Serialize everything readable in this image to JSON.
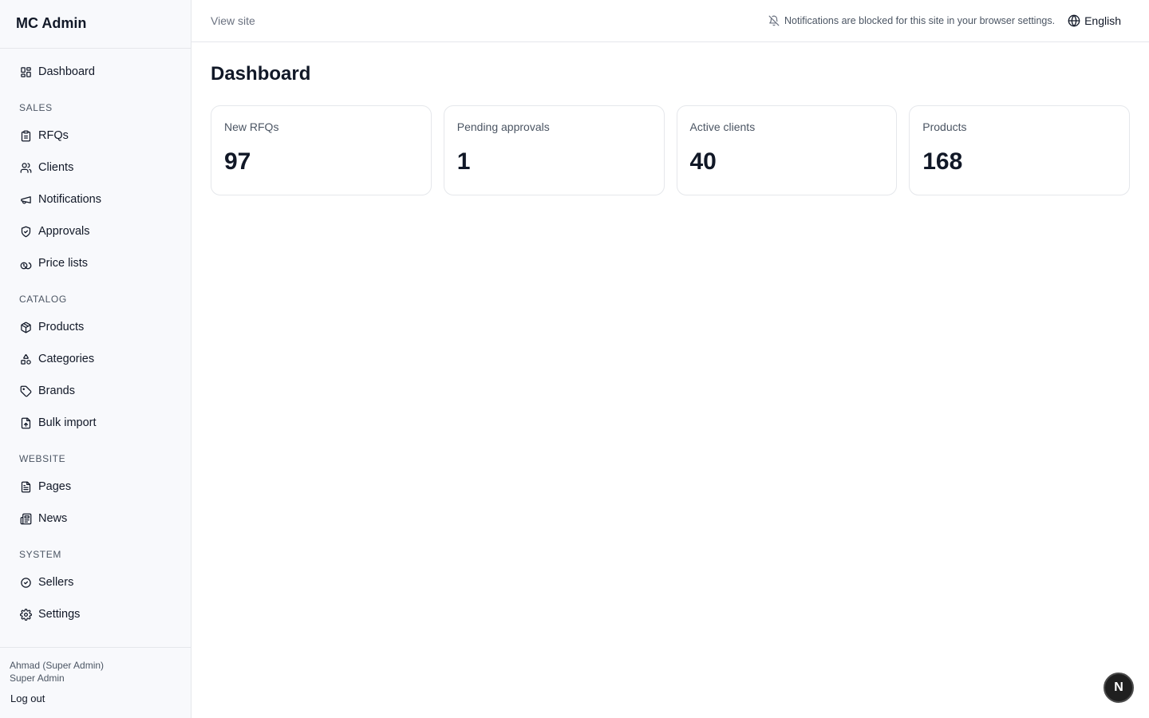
{
  "app": {
    "title": "MC Admin"
  },
  "sidebar": {
    "dashboard": "Dashboard",
    "sections": {
      "sales": "SALES",
      "catalog": "CATALOG",
      "website": "WEBSITE",
      "system": "SYSTEM"
    },
    "items": {
      "rfqs": "RFQs",
      "clients": "Clients",
      "notifications": "Notifications",
      "approvals": "Approvals",
      "price_lists": "Price lists",
      "products": "Products",
      "categories": "Categories",
      "brands": "Brands",
      "bulk_import": "Bulk import",
      "pages": "Pages",
      "news": "News",
      "sellers": "Sellers",
      "settings": "Settings"
    },
    "user": {
      "name": "Ahmad (Super Admin)",
      "role": "Super Admin",
      "logout": "Log out"
    }
  },
  "topbar": {
    "view_site": "View site",
    "notification_warning": "Notifications are blocked for this site in your browser settings.",
    "language": "English"
  },
  "main": {
    "title": "Dashboard",
    "cards": [
      {
        "label": "New RFQs",
        "value": "97"
      },
      {
        "label": "Pending approvals",
        "value": "1"
      },
      {
        "label": "Active clients",
        "value": "40"
      },
      {
        "label": "Products",
        "value": "168"
      }
    ]
  },
  "dev_badge": {
    "label": "N"
  }
}
